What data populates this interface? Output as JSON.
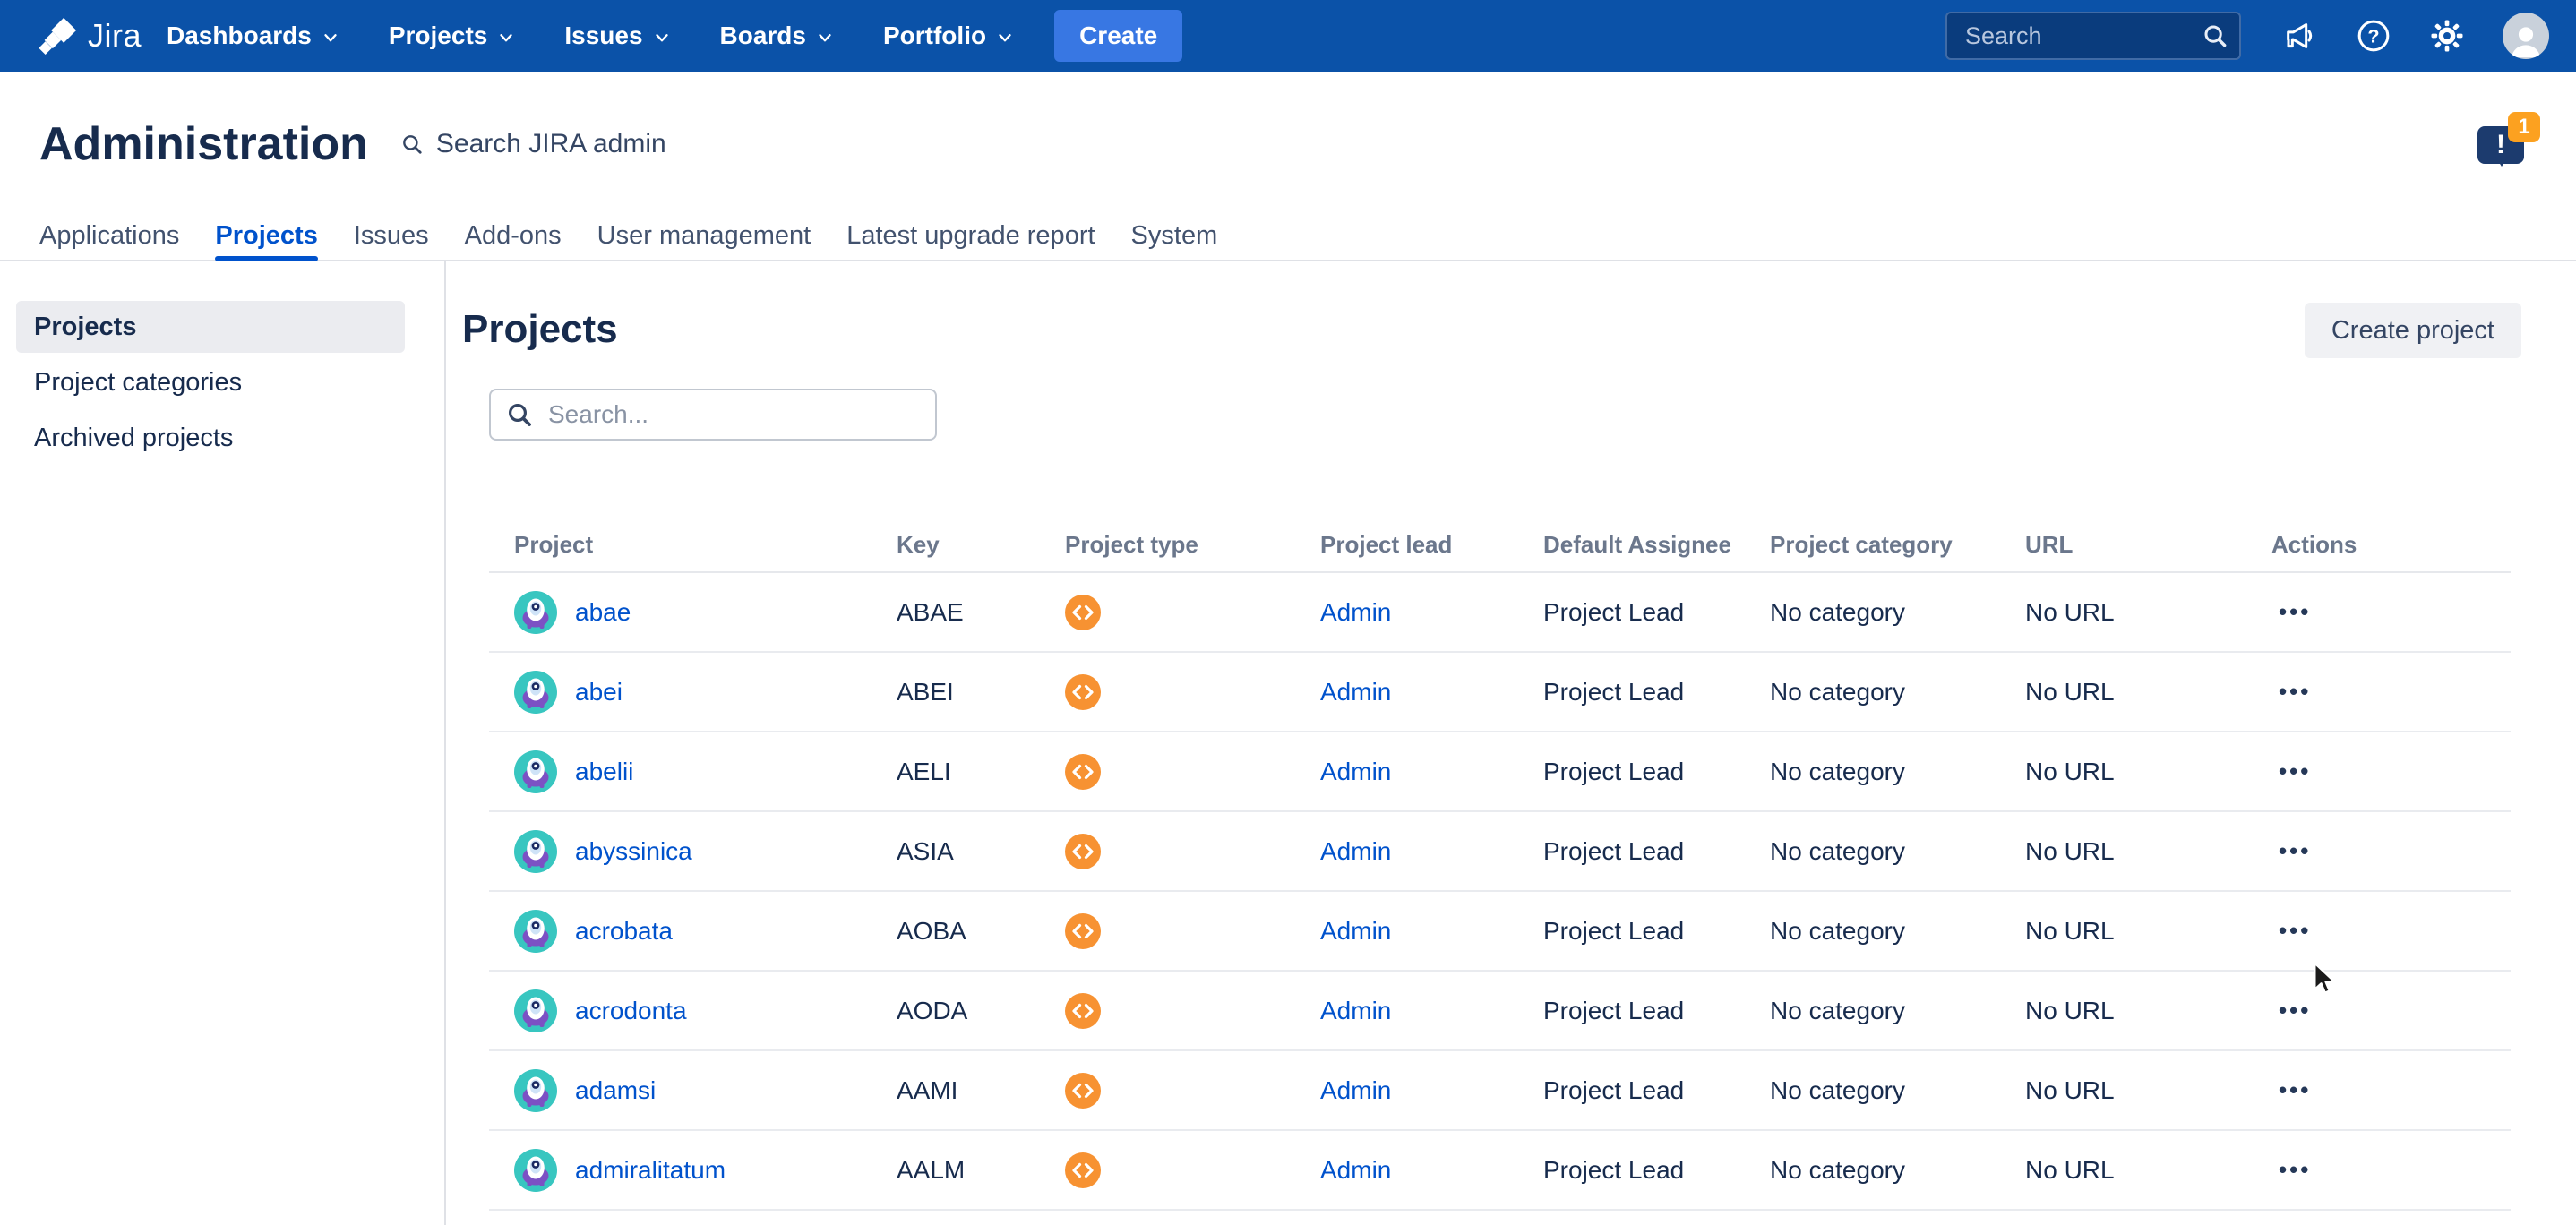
{
  "colors": {
    "navbar": "#0B52A8",
    "create_button": "#3877E3",
    "link": "#0052CC",
    "active_tab": "#0052CC",
    "title": "#172B4D",
    "muted": "#6B778C",
    "sidebar_selected": "#EBECF0",
    "notification": "#1C3B6E",
    "badge": "#FCA120",
    "type_icon_orange": "#F79232",
    "avatar_teal": "#38C6C0",
    "avatar_purple": "#7C51C4"
  },
  "icons": {
    "ellipsis": "•••",
    "help_glyph": "?",
    "notification_glyph": "!"
  },
  "navbar": {
    "brand": "Jira",
    "items": [
      {
        "label": "Dashboards"
      },
      {
        "label": "Projects"
      },
      {
        "label": "Issues"
      },
      {
        "label": "Boards"
      },
      {
        "label": "Portfolio"
      }
    ],
    "create_label": "Create",
    "search_placeholder": "Search"
  },
  "admin_header": {
    "title": "Administration",
    "search_label": "Search JIRA admin",
    "notification_count": "1"
  },
  "tabs": [
    {
      "label": "Applications",
      "active": false
    },
    {
      "label": "Projects",
      "active": true
    },
    {
      "label": "Issues",
      "active": false
    },
    {
      "label": "Add-ons",
      "active": false
    },
    {
      "label": "User management",
      "active": false
    },
    {
      "label": "Latest upgrade report",
      "active": false
    },
    {
      "label": "System",
      "active": false
    }
  ],
  "sidebar": {
    "items": [
      {
        "label": "Projects",
        "active": true
      },
      {
        "label": "Project categories",
        "active": false
      },
      {
        "label": "Archived projects",
        "active": false
      }
    ]
  },
  "main": {
    "title": "Projects",
    "create_button_label": "Create project",
    "search_placeholder": "Search...",
    "table": {
      "columns": [
        "Project",
        "Key",
        "Project type",
        "Project lead",
        "Default Assignee",
        "Project category",
        "URL",
        "Actions"
      ],
      "rows": [
        {
          "name": "abae",
          "key": "ABAE",
          "type": "software",
          "lead": "Admin",
          "default_assignee": "Project Lead",
          "category": "No category",
          "url": "No URL"
        },
        {
          "name": "abei",
          "key": "ABEI",
          "type": "software",
          "lead": "Admin",
          "default_assignee": "Project Lead",
          "category": "No category",
          "url": "No URL"
        },
        {
          "name": "abelii",
          "key": "AELI",
          "type": "software",
          "lead": "Admin",
          "default_assignee": "Project Lead",
          "category": "No category",
          "url": "No URL"
        },
        {
          "name": "abyssinica",
          "key": "ASIA",
          "type": "software",
          "lead": "Admin",
          "default_assignee": "Project Lead",
          "category": "No category",
          "url": "No URL"
        },
        {
          "name": "acrobata",
          "key": "AOBA",
          "type": "software",
          "lead": "Admin",
          "default_assignee": "Project Lead",
          "category": "No category",
          "url": "No URL"
        },
        {
          "name": "acrodonta",
          "key": "AODA",
          "type": "software",
          "lead": "Admin",
          "default_assignee": "Project Lead",
          "category": "No category",
          "url": "No URL"
        },
        {
          "name": "adamsi",
          "key": "AAMI",
          "type": "software",
          "lead": "Admin",
          "default_assignee": "Project Lead",
          "category": "No category",
          "url": "No URL"
        },
        {
          "name": "admiralitatum",
          "key": "AALM",
          "type": "software",
          "lead": "Admin",
          "default_assignee": "Project Lead",
          "category": "No category",
          "url": "No URL"
        }
      ]
    }
  }
}
